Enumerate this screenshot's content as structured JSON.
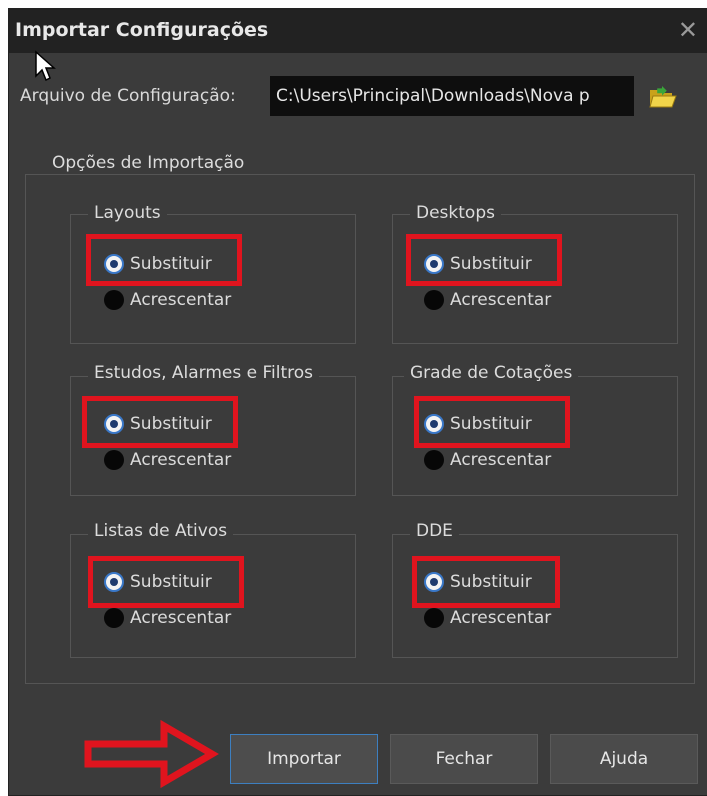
{
  "dialog": {
    "title": "Importar Configurações",
    "close_glyph": "✕"
  },
  "file": {
    "label": "Arquivo de Configuração:",
    "value": "C:\\Users\\Principal\\Downloads\\Nova p"
  },
  "import_options": {
    "legend": "Opções de Importação",
    "groups": [
      {
        "title": "Layouts",
        "options": [
          "Substituir",
          "Acrescentar"
        ],
        "selected": "Substituir"
      },
      {
        "title": "Desktops",
        "options": [
          "Substituir",
          "Acrescentar"
        ],
        "selected": "Substituir"
      },
      {
        "title": "Estudos, Alarmes e Filtros",
        "options": [
          "Substituir",
          "Acrescentar"
        ],
        "selected": "Substituir"
      },
      {
        "title": "Grade de Cotações",
        "options": [
          "Substituir",
          "Acrescentar"
        ],
        "selected": "Substituir"
      },
      {
        "title": "Listas de Ativos",
        "options": [
          "Substituir",
          "Acrescentar"
        ],
        "selected": "Substituir"
      },
      {
        "title": "DDE",
        "options": [
          "Substituir",
          "Acrescentar"
        ],
        "selected": "Substituir"
      }
    ]
  },
  "buttons": {
    "import": "Importar",
    "close": "Fechar",
    "help": "Ajuda"
  },
  "colors": {
    "annotation": "#e0141e",
    "background": "#3b3b3b",
    "titlebar": "#222222",
    "accent": "#3d7fc0"
  },
  "icons": [
    "close-icon",
    "mouse-cursor-icon",
    "folder-open-icon",
    "radio-selected-icon",
    "radio-unselected-icon",
    "annotation-arrow-icon"
  ]
}
